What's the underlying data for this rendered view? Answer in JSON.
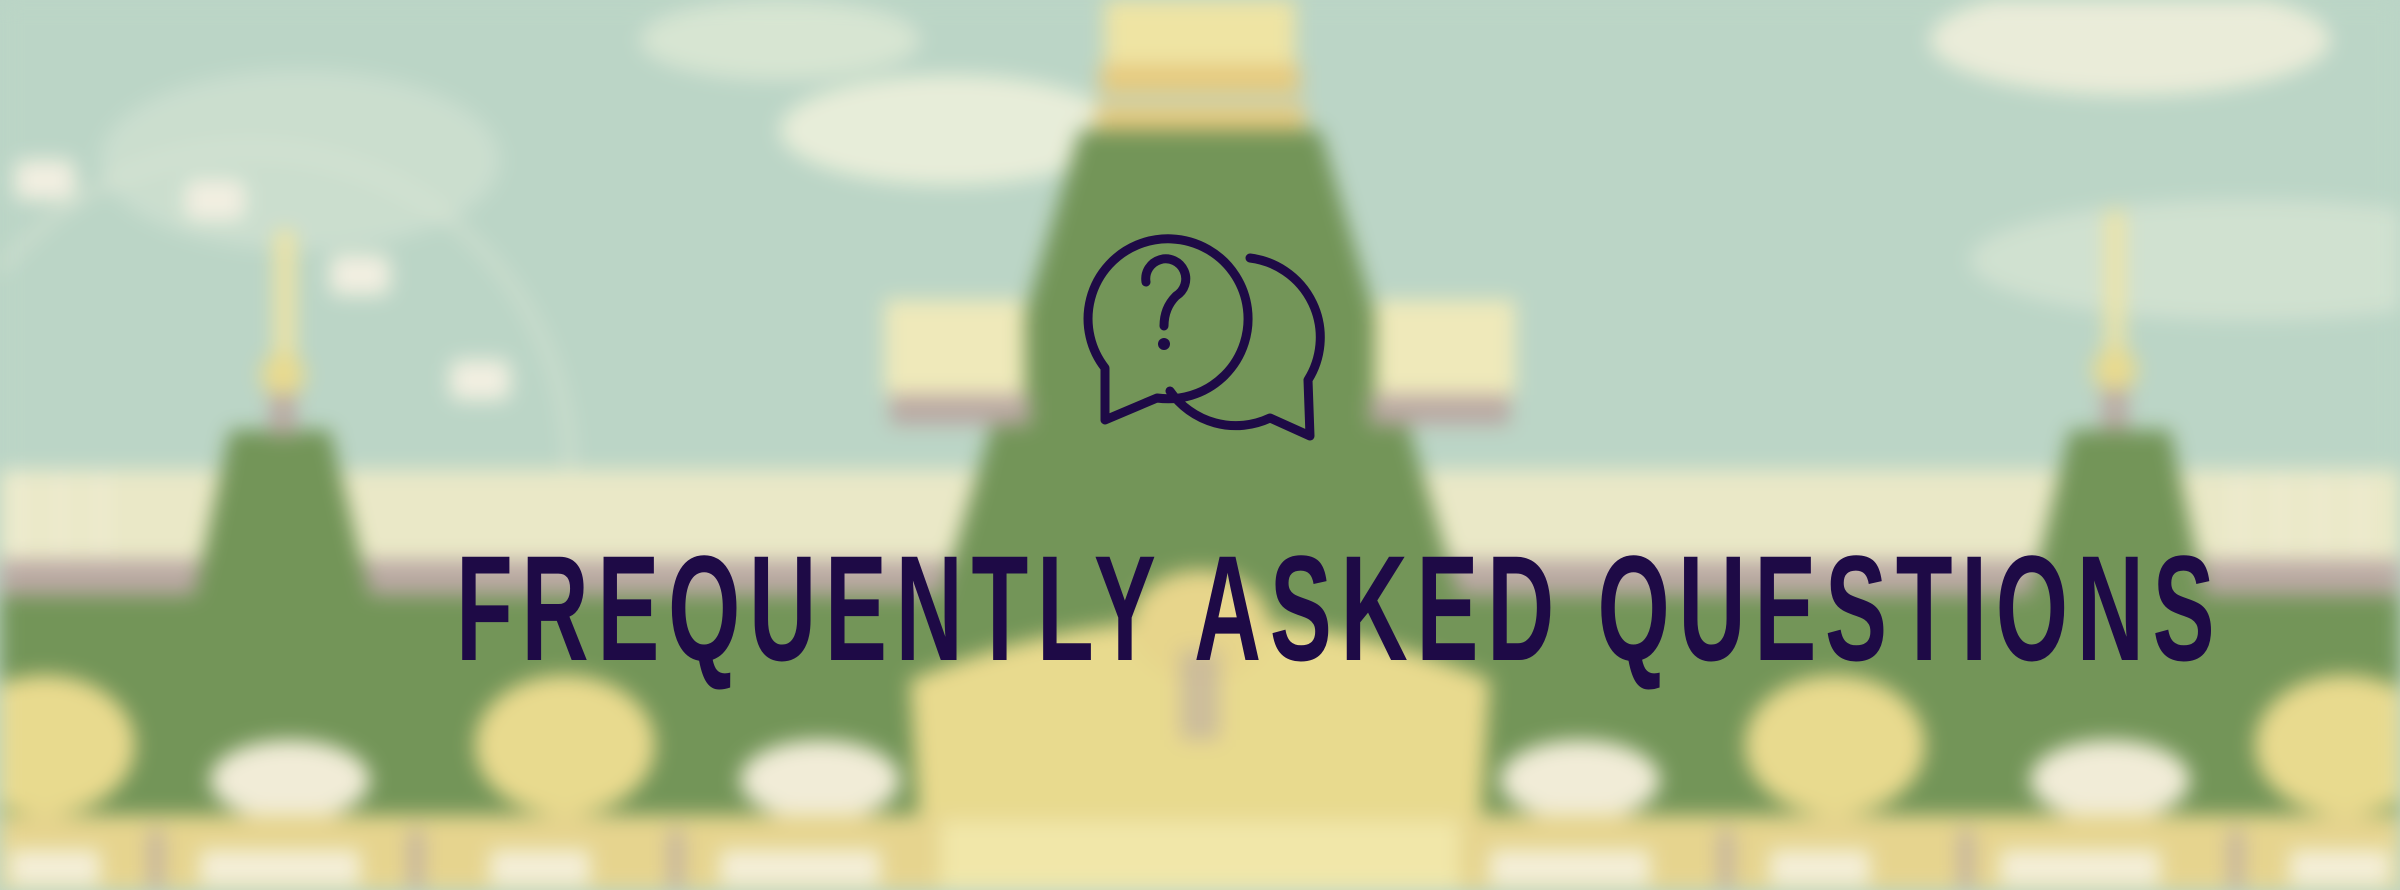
{
  "hero": {
    "title": "FREQUENTLY ASKED QUESTIONS",
    "icon": "question-chat-bubbles-icon",
    "colors": {
      "sky": "#b9d4c4",
      "roof_green": "#6e9152",
      "building_yellow": "#e8d98a",
      "trim_mauve": "#b8a6a0",
      "title_text": "#1e0a46"
    }
  }
}
